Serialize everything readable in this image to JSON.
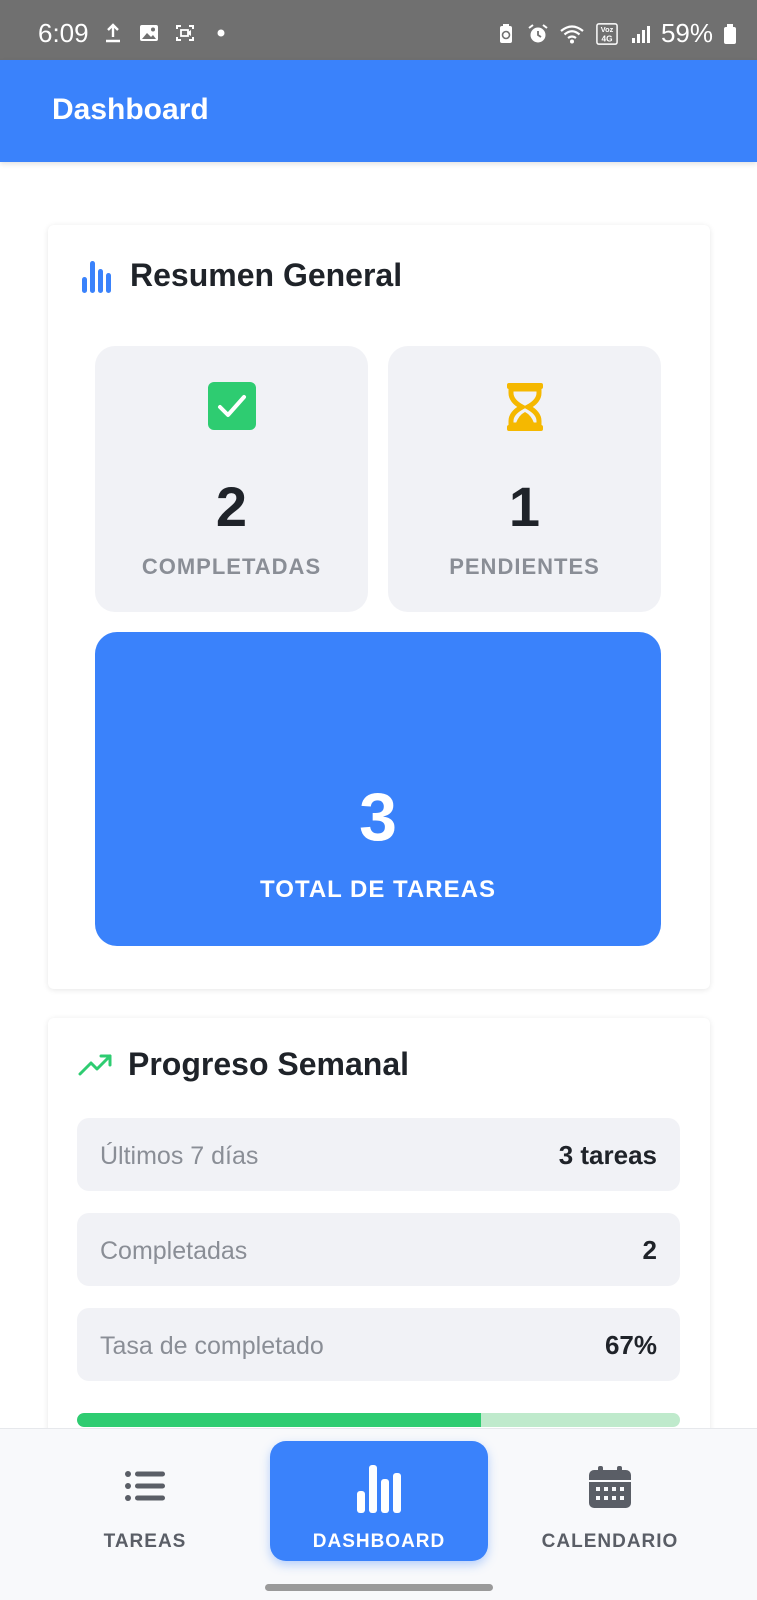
{
  "status_bar": {
    "time": "6:09",
    "battery": "59%",
    "network_label": "Voz 4G"
  },
  "app_bar": {
    "title": "Dashboard"
  },
  "summary": {
    "heading": "Resumen General",
    "completed": {
      "value": "2",
      "label": "COMPLETADAS",
      "icon": "check-square-icon",
      "color": "#2ecc71"
    },
    "pending": {
      "value": "1",
      "label": "PENDIENTES",
      "icon": "hourglass-icon",
      "color": "#f5b800"
    },
    "total": {
      "value": "3",
      "label": "TOTAL DE TAREAS"
    }
  },
  "progress": {
    "heading": "Progreso Semanal",
    "rows": [
      {
        "label": "Últimos 7 días",
        "value": "3 tareas"
      },
      {
        "label": "Completadas",
        "value": "2"
      },
      {
        "label": "Tasa de completado",
        "value": "67%"
      }
    ],
    "completion_fraction": 0.67
  },
  "bottom_nav": {
    "items": [
      {
        "label": "TAREAS",
        "icon": "list-icon"
      },
      {
        "label": "DASHBOARD",
        "icon": "bar-chart-icon",
        "active": true
      },
      {
        "label": "CALENDARIO",
        "icon": "calendar-icon"
      }
    ]
  },
  "colors": {
    "primary": "#3a82fb",
    "success": "#2ecc71",
    "warning": "#f5b800",
    "surface": "#f1f2f6"
  }
}
